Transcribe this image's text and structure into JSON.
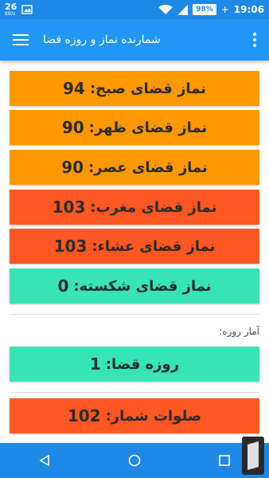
{
  "status": {
    "speed": "26",
    "speed_unit": "KB/s",
    "battery": "98%",
    "time": "19:06"
  },
  "appbar": {
    "title": "شمارنده نماز و روزه قضا"
  },
  "prayers": [
    {
      "label": "نماز قضای صبح:",
      "value": "94",
      "color": "#ff9800"
    },
    {
      "label": "نماز قضای ظهر:",
      "value": "90",
      "color": "#ff9800"
    },
    {
      "label": "نماز قضای عصر:",
      "value": "90",
      "color": "#ff9800"
    },
    {
      "label": "نماز قضای مغرب:",
      "value": "103",
      "color": "#ff5722"
    },
    {
      "label": "نماز قضای عشاء:",
      "value": "103",
      "color": "#ff5722"
    },
    {
      "label": "نماز قضای شکسته:",
      "value": "0",
      "color": "#36e4b7"
    }
  ],
  "fasting": {
    "section_label": "آمار روزه:",
    "label": "روزه قضا:",
    "value": "1",
    "color": "#36e4b7"
  },
  "salawat": {
    "label": "صلوات شمار:",
    "value": "102",
    "color": "#ff5722"
  }
}
